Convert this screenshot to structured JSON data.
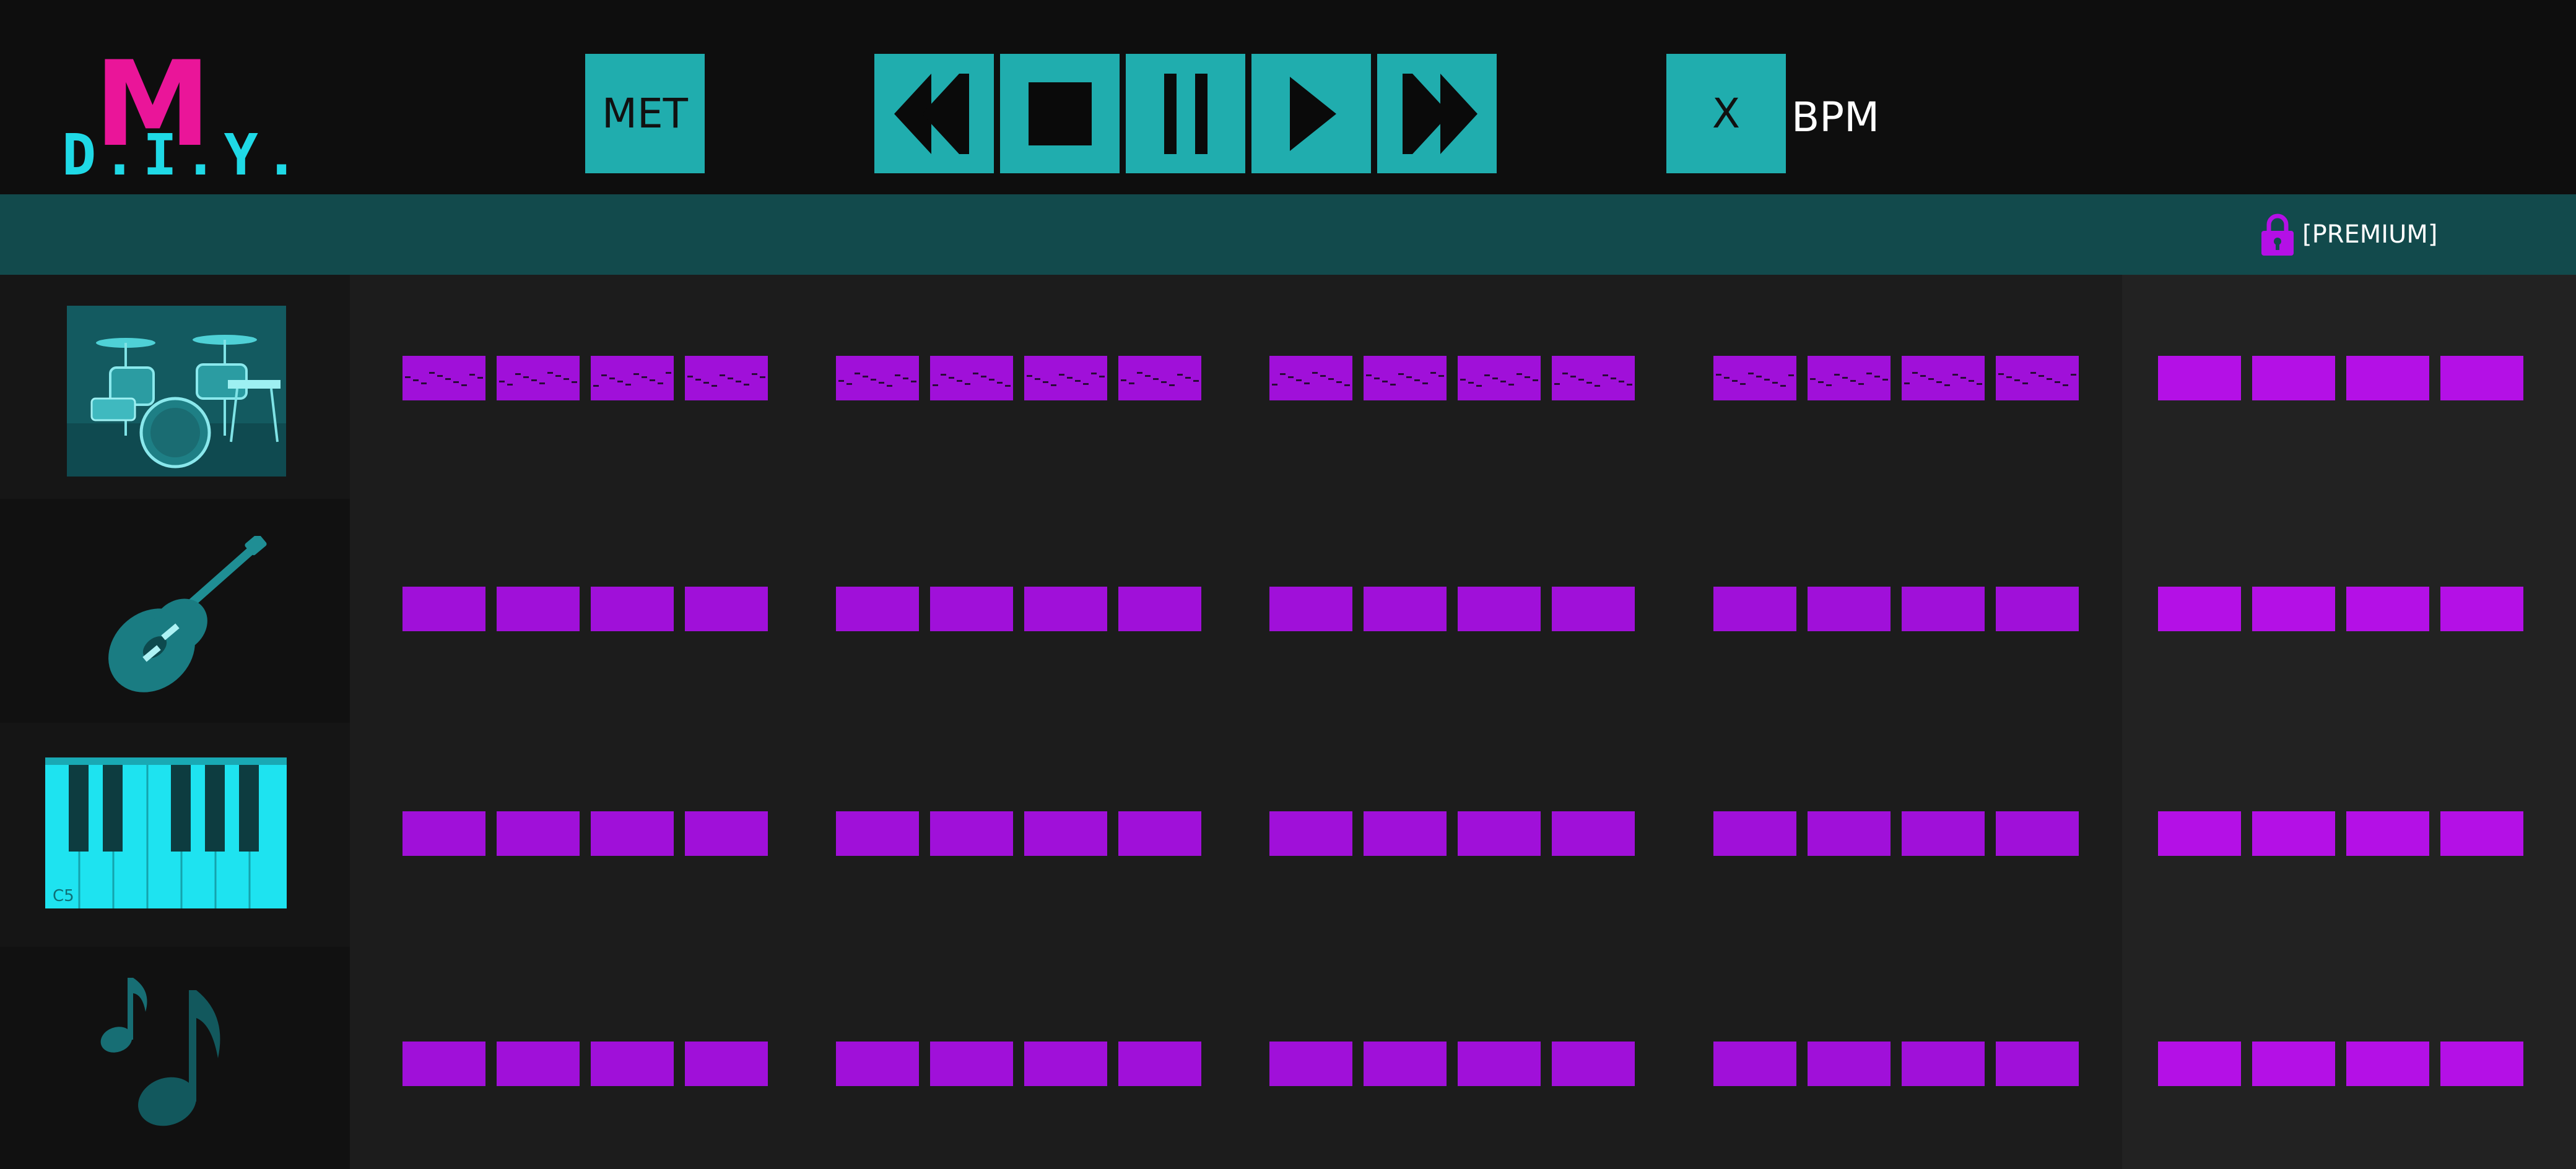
{
  "app": {
    "logo_text": "M. D.I.Y.",
    "colors": {
      "accent_teal": "#20adae",
      "pad_purple": "#a010d9",
      "logo_pink": "#ea1599",
      "logo_cyan": "#1fd9e6"
    }
  },
  "transport": {
    "metronome_label": "MET",
    "buttons": [
      {
        "name": "rewind",
        "icon": "rewind-icon"
      },
      {
        "name": "stop",
        "icon": "stop-icon"
      },
      {
        "name": "pause",
        "icon": "pause-icon"
      },
      {
        "name": "play",
        "icon": "play-icon"
      },
      {
        "name": "fast-forward",
        "icon": "fast-forward-icon"
      }
    ],
    "bpm_value": "X",
    "bpm_label": "BPM"
  },
  "premium": {
    "icon": "lock-icon",
    "label": "[PREMIUM]"
  },
  "instruments": [
    {
      "name": "drums",
      "icon": "drum-kit-icon"
    },
    {
      "name": "guitar",
      "icon": "guitar-icon"
    },
    {
      "name": "piano",
      "icon": "piano-keys-icon",
      "key_label": "C5"
    },
    {
      "name": "notes",
      "icon": "music-notes-icon"
    }
  ],
  "grid": {
    "groups_per_row": 5,
    "cells_per_group": 4,
    "locked_group": 5,
    "drum_row_has_pattern": true
  }
}
